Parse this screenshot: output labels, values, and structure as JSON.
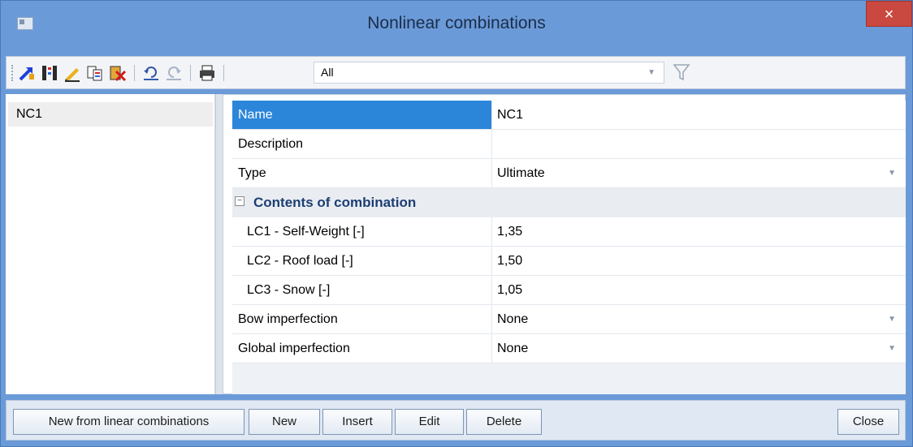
{
  "window": {
    "title": "Nonlinear combinations",
    "close_label": "×"
  },
  "toolbar": {
    "icons": [
      "select-icon",
      "columns-icon",
      "edit-icon",
      "copy-icon",
      "delete-icon",
      "undo-icon",
      "redo-icon",
      "print-icon"
    ],
    "filter_value": "All"
  },
  "list": {
    "items": [
      {
        "label": "NC1",
        "selected": true
      }
    ]
  },
  "properties": {
    "name_label": "Name",
    "name_value": "NC1",
    "description_label": "Description",
    "description_value": "",
    "type_label": "Type",
    "type_value": "Ultimate",
    "section_title": "Contents of combination",
    "section_toggle": "−",
    "load_cases": [
      {
        "label": "LC1 - Self-Weight [-]",
        "value": "1,35"
      },
      {
        "label": "LC2 - Roof load [-]",
        "value": "1,50"
      },
      {
        "label": "LC3 - Snow [-]",
        "value": "1,05"
      }
    ],
    "bow_label": "Bow imperfection",
    "bow_value": "None",
    "global_label": "Global imperfection",
    "global_value": "None"
  },
  "buttons": {
    "new_from_linear": "New from linear combinations",
    "new": "New",
    "insert": "Insert",
    "edit": "Edit",
    "delete": "Delete",
    "close": "Close"
  },
  "colors": {
    "titlebar": "#6b9ad8",
    "selection": "#2b86d9",
    "section_title": "#1d3e73",
    "close_button": "#c9483f"
  }
}
